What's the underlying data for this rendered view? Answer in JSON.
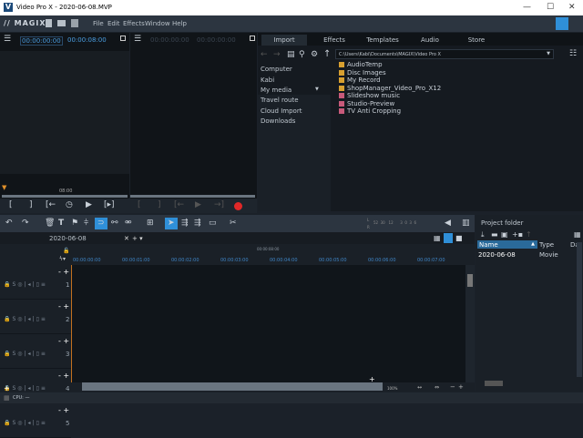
{
  "window": {
    "title": "Video Pro X - 2020-06-08.MVP",
    "logo": "V",
    "minimize": "—",
    "maximize": "☐",
    "close": "✕"
  },
  "menubar": {
    "brand": "// MAGIX",
    "items": [
      "File",
      "Edit",
      "Effects",
      "Window",
      "Help"
    ]
  },
  "preview": {
    "left": {
      "timecode_start": "00:00:00:00",
      "timecode_end": "00:00:08:00",
      "position_label": "08:00"
    },
    "right": {
      "timecode_start": "00:00:00:00",
      "timecode_end": "00:00:00:00"
    }
  },
  "media_pool": {
    "tabs": [
      "Import",
      "Effects",
      "Templates",
      "Audio",
      "Store"
    ],
    "path": "C:\\Users\\Kabi\\Documents\\MAGIX\\Video Pro X",
    "nav": [
      "Computer",
      "Kabi",
      "My media",
      "Travel route",
      "Cloud Import",
      "Downloads"
    ],
    "files": [
      {
        "name": "AudioTemp",
        "type": "folder"
      },
      {
        "name": "Disc Images",
        "type": "folder"
      },
      {
        "name": "My Record",
        "type": "folder"
      },
      {
        "name": "ShopManager_Video_Pro_X12",
        "type": "folder"
      },
      {
        "name": "Slideshow music",
        "type": "special"
      },
      {
        "name": "Studio-Preview",
        "type": "special"
      },
      {
        "name": "TV Anti Cropping",
        "type": "special"
      }
    ]
  },
  "meter": {
    "labels": "52  30   12      3  0  3  6",
    "L": "L",
    "R": "R"
  },
  "timeline": {
    "project_tab": "2020-06-08",
    "close": "✕",
    "add": "+ ▾",
    "top_time": "00:00:08:00",
    "ruler": [
      "00:00:00:00",
      "00:00:01:00",
      "00:00:02:00",
      "00:00:03:00",
      "00:00:04:00",
      "00:00:05:00",
      "00:00:06:00",
      "00:00:07:00"
    ],
    "tracks": [
      "1",
      "2",
      "3",
      "4",
      "5"
    ],
    "zoom": "100%"
  },
  "project_folder": {
    "title": "Project folder",
    "columns": [
      "Name",
      "Type",
      "Da"
    ],
    "rows": [
      {
        "name": "2020-06-08",
        "type": "Movie"
      }
    ]
  },
  "status": {
    "cpu": "CPU: —"
  },
  "colors": {
    "accent": "#2f8fd8",
    "record": "#e02828",
    "folder": "#d8a030",
    "special": "#c85a7a"
  }
}
